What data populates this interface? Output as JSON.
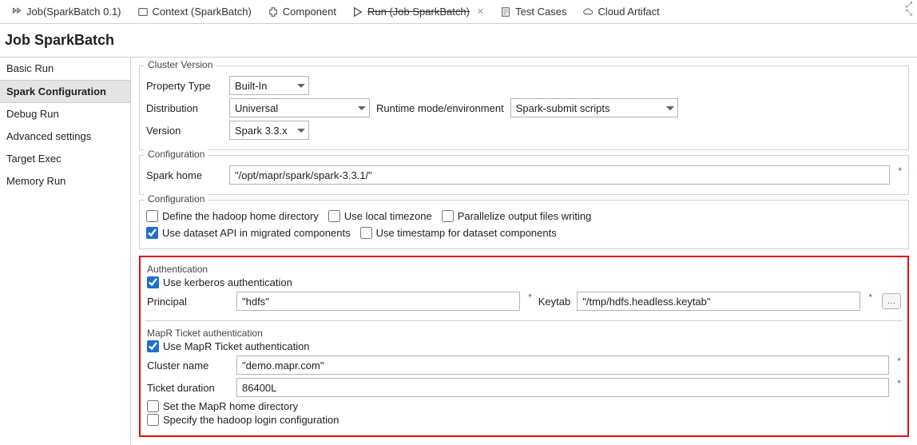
{
  "topTabs": {
    "job": "Job(SparkBatch 0.1)",
    "context": "Context (SparkBatch)",
    "component": "Component",
    "run": "Run (Job SparkBatch)",
    "testCases": "Test Cases",
    "cloudArtifact": "Cloud Artifact"
  },
  "pageTitle": "Job SparkBatch",
  "sidebar": {
    "items": [
      "Basic Run",
      "Spark Configuration",
      "Debug Run",
      "Advanced settings",
      "Target Exec",
      "Memory Run"
    ],
    "selectedIndex": 1
  },
  "clusterVersion": {
    "legend": "Cluster Version",
    "propertyTypeLabel": "Property Type",
    "propertyType": "Built-In",
    "distributionLabel": "Distribution",
    "distribution": "Universal",
    "runtimeModeLabel": "Runtime mode/environment",
    "runtimeMode": "Spark-submit scripts",
    "versionLabel": "Version",
    "version": "Spark 3.3.x"
  },
  "configuration1": {
    "legend": "Configuration",
    "sparkHomeLabel": "Spark home",
    "sparkHome": "\"/opt/mapr/spark/spark-3.3.1/\""
  },
  "configuration2": {
    "legend": "Configuration",
    "defineHadoopHome": {
      "label": "Define the hadoop home directory",
      "checked": false
    },
    "useLocalTimezone": {
      "label": "Use local timezone",
      "checked": false
    },
    "parallelize": {
      "label": "Parallelize output files writing",
      "checked": false
    },
    "useDatasetApi": {
      "label": "Use dataset API in migrated components",
      "checked": true
    },
    "useTimestamp": {
      "label": "Use timestamp for dataset components",
      "checked": false
    }
  },
  "authentication": {
    "legend": "Authentication",
    "useKerberos": {
      "label": "Use kerberos authentication",
      "checked": true
    },
    "principalLabel": "Principal",
    "principal": "\"hdfs\"",
    "keytabLabel": "Keytab",
    "keytab": "\"/tmp/hdfs.headless.keytab\""
  },
  "mapr": {
    "legend": "MapR Ticket authentication",
    "useMapr": {
      "label": "Use MapR Ticket authentication",
      "checked": true
    },
    "clusterNameLabel": "Cluster name",
    "clusterName": "\"demo.mapr.com\"",
    "ticketDurationLabel": "Ticket duration",
    "ticketDuration": "86400L",
    "setMaprHome": {
      "label": "Set the MapR home directory",
      "checked": false
    },
    "specifyHadoopLogin": {
      "label": "Specify the hadoop login configuration",
      "checked": false
    }
  }
}
